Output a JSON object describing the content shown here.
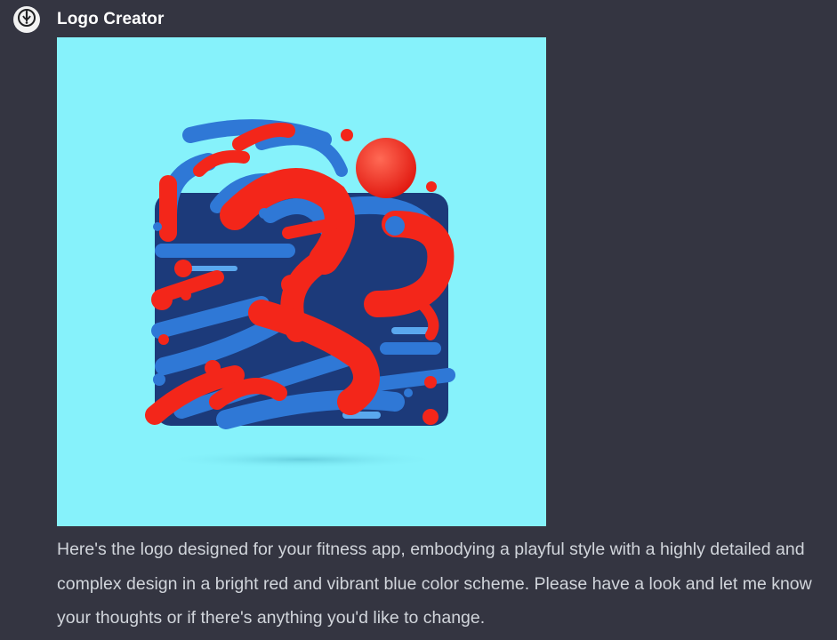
{
  "assistant": {
    "name": "Logo Creator",
    "avatar_icon": "logo-creator-icon"
  },
  "generated_image": {
    "icon": "abstract-runner-logo",
    "colors": {
      "background": "#86f2fb",
      "red": "#f3261a",
      "blue": "#2f78d6",
      "navy": "#1c3a7a"
    }
  },
  "message": {
    "text": "Here's the logo designed for your fitness app, embodying a playful style with a highly detailed and complex design in a bright red and vibrant blue color scheme. Please have a look and let me know your thoughts or if there's anything you'd like to change."
  }
}
